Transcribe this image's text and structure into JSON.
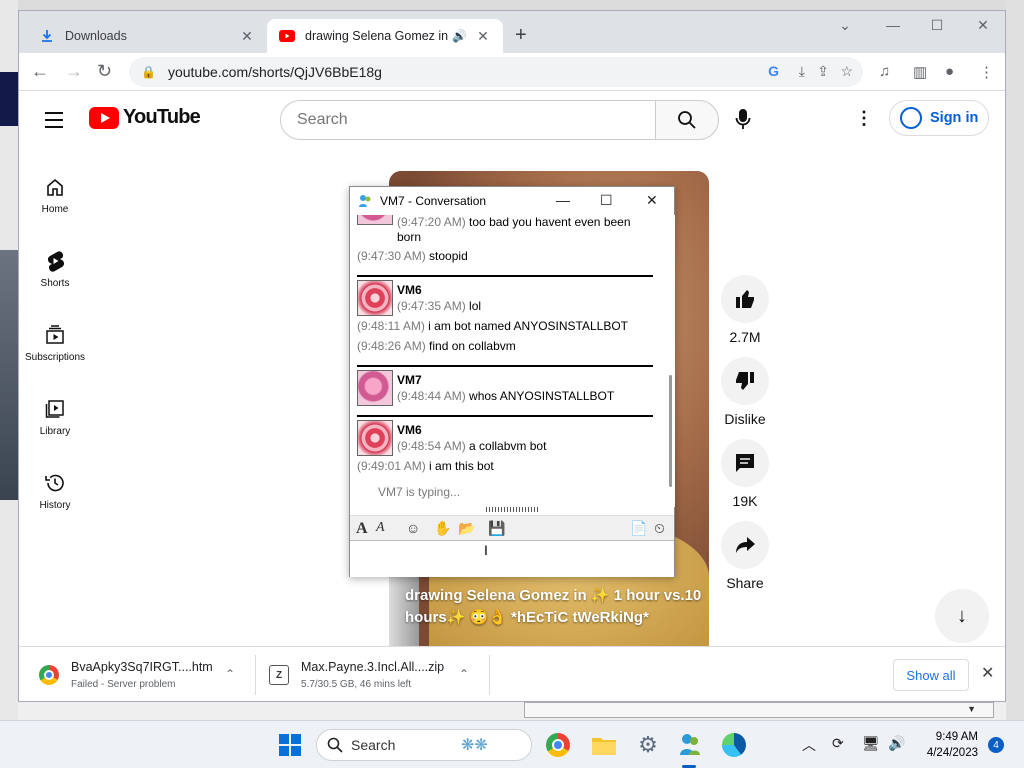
{
  "browser": {
    "tabs": [
      {
        "label": "Downloads",
        "close": "✕"
      },
      {
        "label": "drawing Selena Gomez in ✨",
        "speaker": "🔊",
        "close": "✕"
      }
    ],
    "new_tab": "+",
    "url": "youtube.com/shorts/QjJV6BbE18g",
    "window_controls": {
      "minimize": "—",
      "maximize": "☐",
      "close": "✕"
    },
    "chevron": "⌄"
  },
  "youtube": {
    "logo_text": "YouTube",
    "search_placeholder": "Search",
    "sign_in": "Sign in",
    "guide": [
      {
        "label": "Home",
        "icon": "home-icon"
      },
      {
        "label": "Shorts",
        "icon": "shorts-icon"
      },
      {
        "label": "Subscriptions",
        "icon": "subscriptions-icon"
      },
      {
        "label": "Library",
        "icon": "library-icon"
      },
      {
        "label": "History",
        "icon": "history-icon"
      }
    ],
    "video_caption": "drawing Selena Gomez in ✨ 1 hour vs.10 hours✨ 😳👌 *hEcTiC tWeRkiNg*",
    "actions": {
      "likes": "2.7M",
      "dislike": "Dislike",
      "comments": "19K",
      "share": "Share"
    }
  },
  "conversation": {
    "title": "VM7 - Conversation",
    "messages_top": [
      {
        "time": "(9:47:20 AM)",
        "text": "too bad you havent even been"
      },
      {
        "cont": "born"
      },
      {
        "time": "(9:47:30 AM)",
        "text": "stoopid"
      }
    ],
    "block1": {
      "sender": "VM6",
      "first": {
        "time": "(9:47:35 AM)",
        "text": "lol"
      },
      "rest": [
        {
          "time": "(9:48:11 AM)",
          "text": "i am bot named ANYOSINSTALLBOT"
        },
        {
          "time": "(9:48:26 AM)",
          "text": "find on collabvm"
        }
      ]
    },
    "block2": {
      "sender": "VM7",
      "first": {
        "time": "(9:48:44 AM)",
        "text": "whos ANYOSINSTALLBOT"
      }
    },
    "block3": {
      "sender": "VM6",
      "first": {
        "time": "(9:48:54 AM)",
        "text": "a collabvm bot"
      },
      "rest": [
        {
          "time": "(9:49:01 AM)",
          "text": "i am this bot"
        }
      ]
    },
    "typing": "VM7 is typing...",
    "controls": {
      "minimize": "—",
      "maximize": "☐",
      "close": "✕"
    }
  },
  "downloads": [
    {
      "name": "BvaApky3Sq7IRGT....htm",
      "status": "Failed - Server problem"
    },
    {
      "name": "Max.Payne.3.Incl.All....zip",
      "status": "5.7/30.5 GB, 46 mins left"
    }
  ],
  "show_all": "Show all",
  "taskbar": {
    "search_placeholder": "Search",
    "time": "9:49 AM",
    "date": "4/24/2023",
    "notifications": "4"
  },
  "colors": {
    "youtube_red": "#ff0000",
    "link_blue": "#065fd4",
    "chrome_blue": "#1a73e8",
    "windows_blue": "#0a5fc6"
  }
}
